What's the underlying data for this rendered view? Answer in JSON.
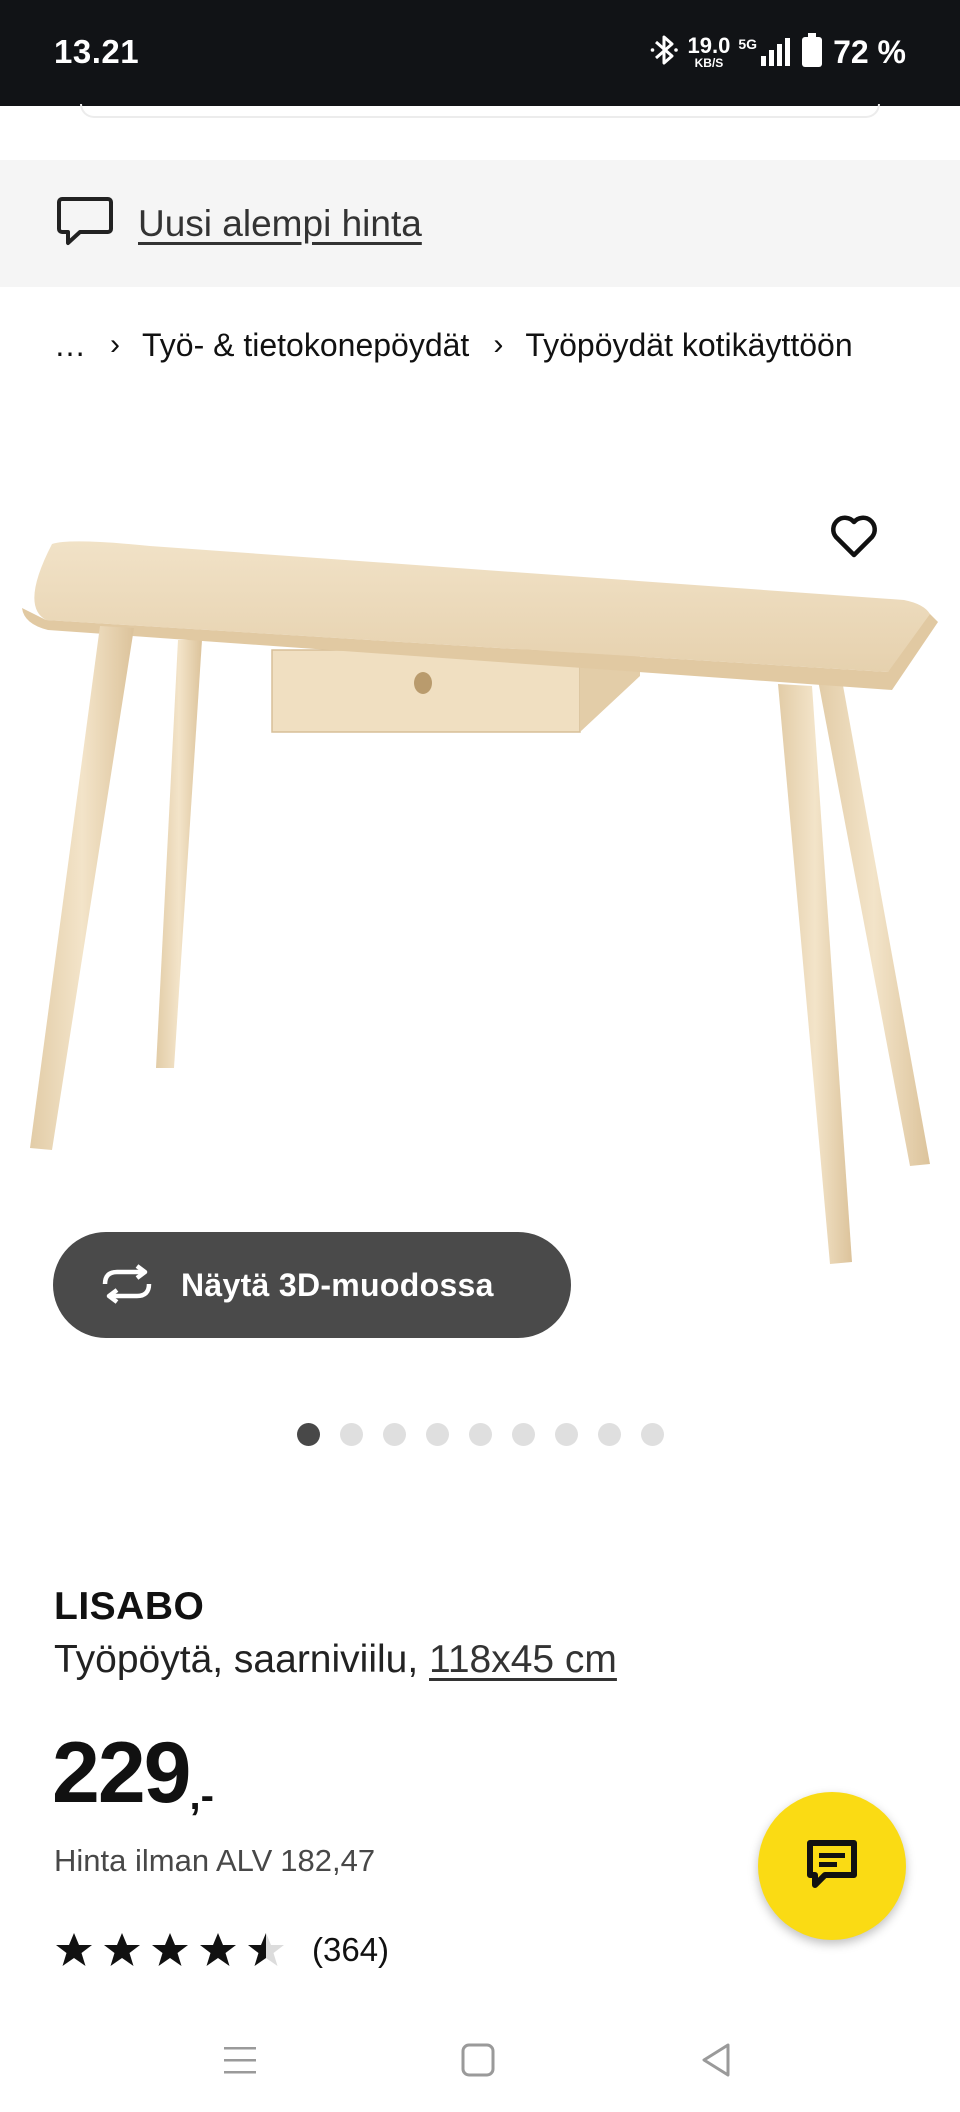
{
  "status_bar": {
    "time": "13.21",
    "speed_value": "19.0",
    "speed_unit": "KB/S",
    "network": "5G",
    "battery": "72 %",
    "icons": [
      "bluetooth-icon",
      "signal-icon",
      "battery-icon"
    ]
  },
  "banner": {
    "icon": "chat-bubble-icon",
    "text": "Uusi alempi hinta"
  },
  "breadcrumb": {
    "items": [
      "…",
      "Työ- & tietokonepöydät",
      "Työpöydät kotikäyttöön"
    ]
  },
  "gallery": {
    "favorite_icon": "heart-icon",
    "view_3d_icon": "rotate-3d-icon",
    "view_3d_label": "Näytä 3D-muodossa",
    "image_count": 9,
    "active_index": 0
  },
  "product": {
    "name": "LISABO",
    "description": "Työpöytä, saarniviilu,",
    "size": "118x45 cm",
    "price_integer": "229",
    "price_suffix": ",-",
    "price_without_vat_label": "Hinta ilman ALV",
    "price_without_vat_value": "182,47",
    "rating": 4.5,
    "rating_max": 5,
    "review_count": "(364)"
  },
  "chat": {
    "icon": "chat-icon"
  },
  "colors": {
    "status_bar_bg": "#111316",
    "banner_bg": "#f5f5f5",
    "button_dark": "#4a4a4a",
    "chat_yellow": "#fadb14",
    "wood": "#eedcbd"
  },
  "nav_bar": {
    "icons": [
      "menu-icon",
      "home-icon",
      "back-icon"
    ]
  }
}
